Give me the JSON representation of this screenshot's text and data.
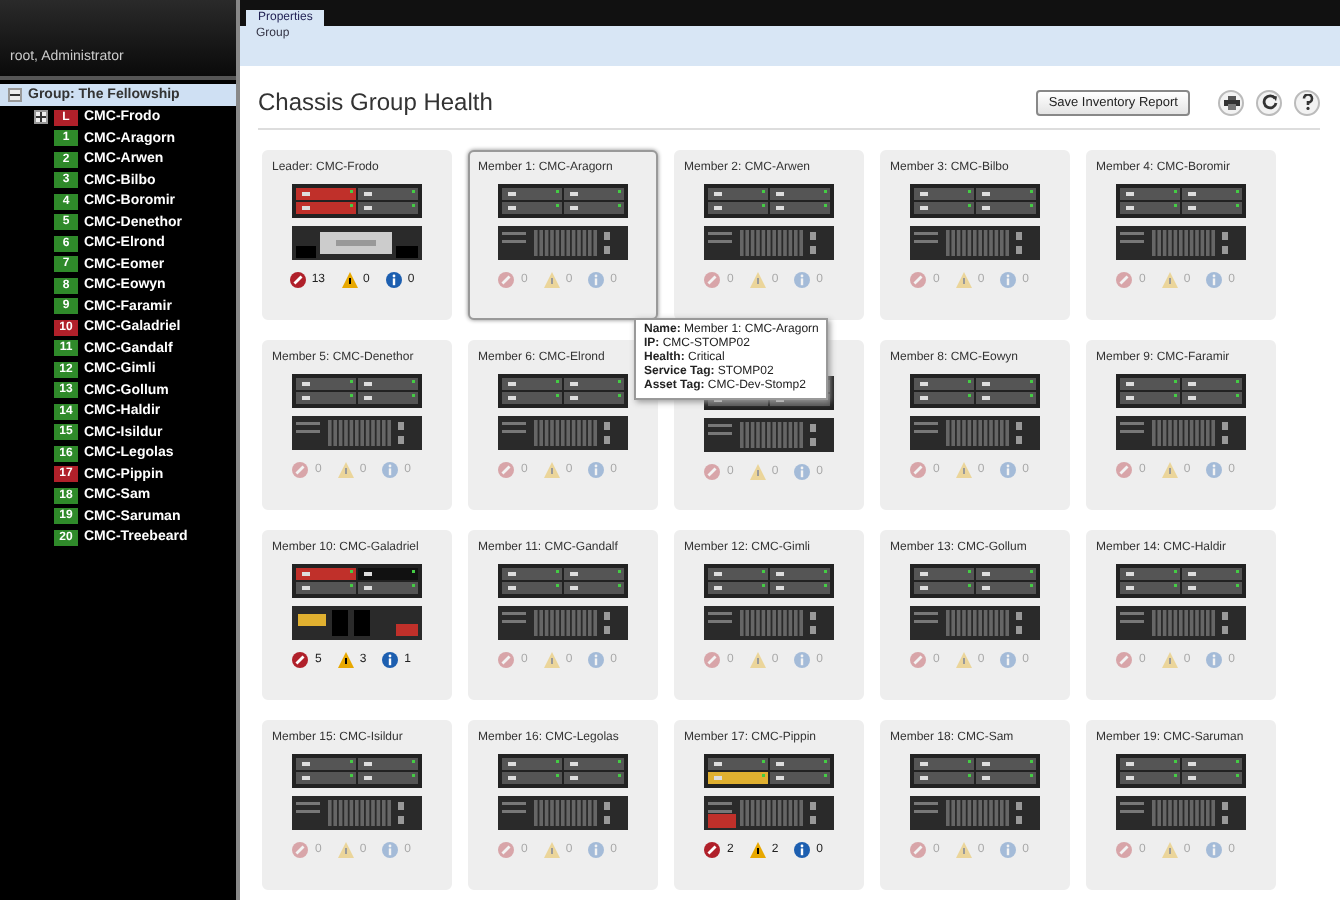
{
  "header": {
    "user": "root, Administrator"
  },
  "tabs": [
    {
      "label": "Properties",
      "selected": true
    }
  ],
  "subtabs": [
    {
      "label": "Group",
      "selected": true
    }
  ],
  "tree": {
    "label": "Group: The Fellowship",
    "selected": true,
    "expanded": true,
    "children": [
      {
        "badge": "L",
        "label": "CMC-Frodo",
        "color": "#b0202a",
        "expanded": false
      },
      {
        "badge": "1",
        "label": "CMC-Aragorn",
        "color": "#2f8a2a"
      },
      {
        "badge": "2",
        "label": "CMC-Arwen",
        "color": "#2f8a2a"
      },
      {
        "badge": "3",
        "label": "CMC-Bilbo",
        "color": "#2f8a2a"
      },
      {
        "badge": "4",
        "label": "CMC-Boromir",
        "color": "#2f8a2a"
      },
      {
        "badge": "5",
        "label": "CMC-Denethor",
        "color": "#2f8a2a"
      },
      {
        "badge": "6",
        "label": "CMC-Elrond",
        "color": "#2f8a2a"
      },
      {
        "badge": "7",
        "label": "CMC-Eomer",
        "color": "#2f8a2a"
      },
      {
        "badge": "8",
        "label": "CMC-Eowyn",
        "color": "#2f8a2a"
      },
      {
        "badge": "9",
        "label": "CMC-Faramir",
        "color": "#2f8a2a"
      },
      {
        "badge": "10",
        "label": "CMC-Galadriel",
        "color": "#b0202a"
      },
      {
        "badge": "11",
        "label": "CMC-Gandalf",
        "color": "#2f8a2a"
      },
      {
        "badge": "12",
        "label": "CMC-Gimli",
        "color": "#2f8a2a"
      },
      {
        "badge": "13",
        "label": "CMC-Gollum",
        "color": "#2f8a2a"
      },
      {
        "badge": "14",
        "label": "CMC-Haldir",
        "color": "#2f8a2a"
      },
      {
        "badge": "15",
        "label": "CMC-Isildur",
        "color": "#2f8a2a"
      },
      {
        "badge": "16",
        "label": "CMC-Legolas",
        "color": "#2f8a2a"
      },
      {
        "badge": "17",
        "label": "CMC-Pippin",
        "color": "#b0202a"
      },
      {
        "badge": "18",
        "label": "CMC-Sam",
        "color": "#2f8a2a"
      },
      {
        "badge": "19",
        "label": "CMC-Saruman",
        "color": "#2f8a2a"
      },
      {
        "badge": "20",
        "label": "CMC-Treebeard",
        "color": "#2f8a2a"
      }
    ]
  },
  "page_title": "Chassis Group Health",
  "save_button": "Save Inventory Report",
  "cards": [
    {
      "title": "Leader: CMC-Frodo",
      "selected": false,
      "units": [
        {
          "kind": "criticalblade"
        },
        {
          "kind": "leaderstorage"
        }
      ],
      "active": true,
      "critical": "13",
      "warning": "0",
      "info": "0"
    },
    {
      "title": "Member 1: CMC-Aragorn",
      "selected": true,
      "units": [
        {
          "kind": "normalblade"
        },
        {
          "kind": "normalstorage"
        }
      ],
      "active": false,
      "critical": "0",
      "warning": "0",
      "info": "0"
    },
    {
      "title": "Member 2: CMC-Arwen",
      "selected": false,
      "units": [
        {
          "kind": "normalblade"
        },
        {
          "kind": "normalstorage"
        }
      ],
      "active": false,
      "critical": "0",
      "warning": "0",
      "info": "0"
    },
    {
      "title": "Member 3: CMC-Bilbo",
      "selected": false,
      "units": [
        {
          "kind": "normalblade"
        },
        {
          "kind": "normalstorage"
        }
      ],
      "active": false,
      "critical": "0",
      "warning": "0",
      "info": "0"
    },
    {
      "title": "Member 4: CMC-Boromir",
      "selected": false,
      "units": [
        {
          "kind": "normalblade"
        },
        {
          "kind": "normalstorage"
        }
      ],
      "active": false,
      "critical": "0",
      "warning": "0",
      "info": "0"
    },
    {
      "title": "Member 5: CMC-Denethor",
      "selected": false,
      "units": [
        {
          "kind": "normalblade"
        },
        {
          "kind": "normalstorage"
        }
      ],
      "active": false,
      "critical": "0",
      "warning": "0",
      "info": "0"
    },
    {
      "title": "Member 6: CMC-Elrond",
      "selected": false,
      "units": [
        {
          "kind": "normalblade"
        },
        {
          "kind": "normalstorage"
        }
      ],
      "active": false,
      "critical": "0",
      "warning": "0",
      "info": "0"
    },
    {
      "selected": false,
      "units": [
        {
          "kind": "normalblade"
        },
        {
          "kind": "normalstorage"
        }
      ],
      "active": false,
      "critical": "0",
      "warning": "0",
      "info": "0"
    },
    {
      "title": "Member 8: CMC-Eowyn",
      "selected": false,
      "units": [
        {
          "kind": "normalblade"
        },
        {
          "kind": "normalstorage"
        }
      ],
      "active": false,
      "critical": "0",
      "warning": "0",
      "info": "0"
    },
    {
      "title": "Member 9: CMC-Faramir",
      "selected": false,
      "units": [
        {
          "kind": "normalblade"
        },
        {
          "kind": "normalstorage"
        }
      ],
      "active": false,
      "critical": "0",
      "warning": "0",
      "info": "0"
    },
    {
      "title": "Member 10: CMC-Galadriel",
      "selected": false,
      "units": [
        {
          "kind": "faultblade"
        },
        {
          "kind": "degradedstorage"
        }
      ],
      "active": true,
      "critical": "5",
      "warning": "3",
      "info": "1"
    },
    {
      "title": "Member 11: CMC-Gandalf",
      "selected": false,
      "units": [
        {
          "kind": "normalblade"
        },
        {
          "kind": "normalstorage"
        }
      ],
      "active": false,
      "critical": "0",
      "warning": "0",
      "info": "0"
    },
    {
      "title": "Member 12: CMC-Gimli",
      "selected": false,
      "units": [
        {
          "kind": "normalblade"
        },
        {
          "kind": "normalstorage"
        }
      ],
      "active": false,
      "critical": "0",
      "warning": "0",
      "info": "0"
    },
    {
      "title": "Member 13: CMC-Gollum",
      "selected": false,
      "units": [
        {
          "kind": "normalblade"
        },
        {
          "kind": "normalstorage"
        }
      ],
      "active": false,
      "critical": "0",
      "warning": "0",
      "info": "0"
    },
    {
      "title": "Member 14: CMC-Haldir",
      "selected": false,
      "units": [
        {
          "kind": "normalblade"
        },
        {
          "kind": "normalstorage"
        }
      ],
      "active": false,
      "critical": "0",
      "warning": "0",
      "info": "0"
    },
    {
      "title": "Member 15: CMC-Isildur",
      "selected": false,
      "units": [
        {
          "kind": "normalblade"
        },
        {
          "kind": "normalstorage"
        }
      ],
      "active": false,
      "critical": "0",
      "warning": "0",
      "info": "0"
    },
    {
      "title": "Member 16: CMC-Legolas",
      "selected": false,
      "units": [
        {
          "kind": "normalblade"
        },
        {
          "kind": "normalstorage"
        }
      ],
      "active": false,
      "critical": "0",
      "warning": "0",
      "info": "0"
    },
    {
      "title": "Member 17: CMC-Pippin",
      "selected": false,
      "units": [
        {
          "kind": "warningblade"
        },
        {
          "kind": "criticalstorage"
        }
      ],
      "active": true,
      "critical": "2",
      "warning": "2",
      "info": "0"
    },
    {
      "title": "Member 18: CMC-Sam",
      "selected": false,
      "units": [
        {
          "kind": "normalblade"
        },
        {
          "kind": "normalstorage"
        }
      ],
      "active": false,
      "critical": "0",
      "warning": "0",
      "info": "0"
    },
    {
      "title": "Member 19: CMC-Saruman",
      "selected": false,
      "units": [
        {
          "kind": "normalblade"
        },
        {
          "kind": "normalstorage"
        }
      ],
      "active": false,
      "critical": "0",
      "warning": "0",
      "info": "0"
    }
  ],
  "tooltip": [
    {
      "label": "Name:",
      "value": "Member 1: CMC-Aragorn"
    },
    {
      "label": "IP:",
      "value": "CMC-STOMP02"
    },
    {
      "label": "Health:",
      "value": "Critical"
    },
    {
      "label": "Service Tag:",
      "value": "STOMP02"
    },
    {
      "label": "Asset Tag:",
      "value": "CMC-Dev-Stomp2"
    }
  ]
}
